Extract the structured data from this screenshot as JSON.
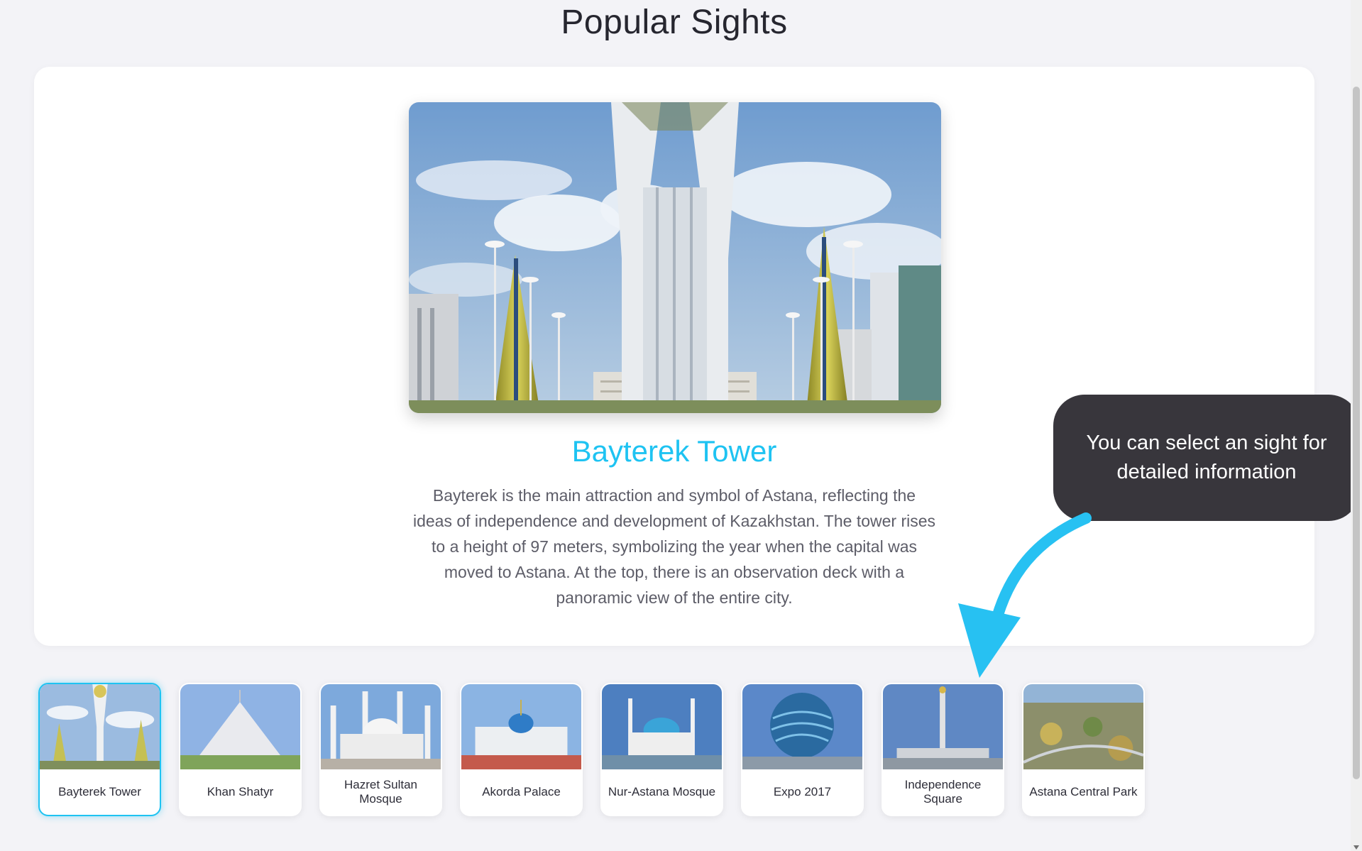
{
  "page": {
    "title": "Popular Sights"
  },
  "selected": {
    "title": "Bayterek Tower",
    "description": "Bayterek is the main attraction and symbol of Astana, reflecting the ideas of independence and development of Kazakhstan. The tower rises to a height of 97 meters, symbolizing the year when the capital was moved to Astana. At the top, there is an observation deck with a panoramic view of the entire city."
  },
  "sights": [
    {
      "label": "Bayterek Tower",
      "active": true
    },
    {
      "label": "Khan Shatyr",
      "active": false
    },
    {
      "label": "Hazret Sultan Mosque",
      "active": false
    },
    {
      "label": "Akorda Palace",
      "active": false
    },
    {
      "label": "Nur-Astana Mosque",
      "active": false
    },
    {
      "label": "Expo 2017",
      "active": false
    },
    {
      "label": "Independence Square",
      "active": false
    },
    {
      "label": "Astana Central Park",
      "active": false
    }
  ],
  "tooltip": {
    "text": "You can select an sight for detailed information"
  },
  "colors": {
    "accent": "#1ec3f2",
    "tooltip_bg": "#38363c",
    "page_bg": "#f3f3f7"
  }
}
